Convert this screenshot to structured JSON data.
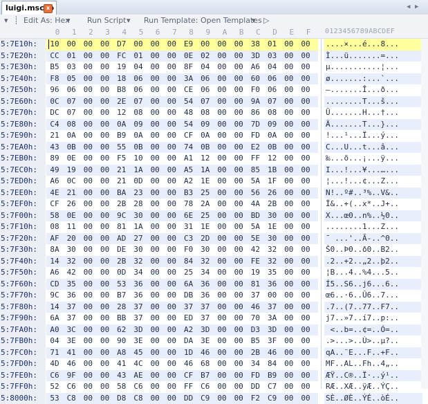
{
  "tab": {
    "title": "luigi.mscsb",
    "close_glyph": "x"
  },
  "toolbar": {
    "edit_as": "Edit As: Hex",
    "run_script": "Run Script",
    "run_template": "Run Template: Open Templates",
    "play_glyph": "▷"
  },
  "header": {
    "columns": [
      "0",
      "1",
      "2",
      "3",
      "4",
      "5",
      "6",
      "7",
      "8",
      "9",
      "A",
      "B",
      "C",
      "D",
      "E",
      "F"
    ],
    "ascii_header": "0123456789ABCDEF"
  },
  "rows": [
    {
      "addr": "5:7E10h:",
      "hex": [
        "10",
        "00",
        "00",
        "00",
        "D7",
        "00",
        "00",
        "00",
        "E9",
        "00",
        "00",
        "00",
        "38",
        "01",
        "00",
        "00"
      ],
      "ascii": "....×...é...8..."
    },
    {
      "addr": "5:7E20h:",
      "hex": [
        "CC",
        "01",
        "00",
        "00",
        "FC",
        "01",
        "00",
        "00",
        "0E",
        "02",
        "00",
        "00",
        "3D",
        "03",
        "00",
        "00"
      ],
      "ascii": "Ì...ü.......=..."
    },
    {
      "addr": "5:7E30h:",
      "hex": [
        "B5",
        "03",
        "00",
        "00",
        "19",
        "04",
        "00",
        "00",
        "8F",
        "04",
        "00",
        "00",
        "A6",
        "04",
        "00",
        "00"
      ],
      "ascii": "µ...........¦..."
    },
    {
      "addr": "5:7E40h:",
      "hex": [
        "F8",
        "05",
        "00",
        "00",
        "18",
        "06",
        "00",
        "00",
        "3A",
        "06",
        "00",
        "00",
        "60",
        "06",
        "00",
        "00"
      ],
      "ascii": "ø.......:...`..."
    },
    {
      "addr": "5:7E50h:",
      "hex": [
        "96",
        "06",
        "00",
        "00",
        "B8",
        "06",
        "00",
        "00",
        "CE",
        "06",
        "00",
        "00",
        "F0",
        "06",
        "00",
        "00"
      ],
      "ascii": "–.......Î...ð..."
    },
    {
      "addr": "5:7E60h:",
      "hex": [
        "0C",
        "07",
        "00",
        "00",
        "2E",
        "07",
        "00",
        "00",
        "54",
        "07",
        "00",
        "00",
        "9A",
        "07",
        "00",
        "00"
      ],
      "ascii": "........T...š..."
    },
    {
      "addr": "5:7E70h:",
      "hex": [
        "DC",
        "07",
        "00",
        "00",
        "12",
        "08",
        "00",
        "00",
        "48",
        "08",
        "00",
        "00",
        "86",
        "08",
        "00",
        "00"
      ],
      "ascii": "Ü.......H...†..."
    },
    {
      "addr": "5:7E80h:",
      "hex": [
        "C4",
        "08",
        "00",
        "00",
        "0A",
        "09",
        "00",
        "00",
        "54",
        "09",
        "00",
        "00",
        "7D",
        "09",
        "00",
        "00"
      ],
      "ascii": "Ä.......T...}..."
    },
    {
      "addr": "5:7E90h:",
      "hex": [
        "21",
        "0A",
        "00",
        "00",
        "B9",
        "0A",
        "00",
        "00",
        "CF",
        "0A",
        "00",
        "00",
        "FD",
        "0A",
        "00",
        "00"
      ],
      "ascii": "!...¹...Ï...ý..."
    },
    {
      "addr": "5:7EA0h:",
      "hex": [
        "43",
        "0B",
        "00",
        "00",
        "55",
        "0B",
        "00",
        "00",
        "74",
        "0B",
        "00",
        "00",
        "E2",
        "0B",
        "00",
        "00"
      ],
      "ascii": "C...U...t...â..."
    },
    {
      "addr": "5:7EB0h:",
      "hex": [
        "89",
        "0E",
        "00",
        "00",
        "F5",
        "10",
        "00",
        "00",
        "A1",
        "12",
        "00",
        "00",
        "FF",
        "12",
        "00",
        "00"
      ],
      "ascii": "‰...õ...¡...ÿ..."
    },
    {
      "addr": "5:7EC0h:",
      "hex": [
        "49",
        "19",
        "00",
        "00",
        "21",
        "1A",
        "00",
        "00",
        "A5",
        "1A",
        "00",
        "00",
        "85",
        "1B",
        "00",
        "00"
      ],
      "ascii": "I...!...¥...…..."
    },
    {
      "addr": "5:7ED0h:",
      "hex": [
        "A6",
        "0C",
        "00",
        "00",
        "21",
        "0D",
        "00",
        "00",
        "A2",
        "1E",
        "00",
        "00",
        "5A",
        "1F",
        "00",
        "00"
      ],
      "ascii": "¦...!...¢...Z..."
    },
    {
      "addr": "5:7EE0h:",
      "hex": [
        "4E",
        "21",
        "00",
        "00",
        "BA",
        "23",
        "00",
        "00",
        "B3",
        "25",
        "00",
        "00",
        "56",
        "26",
        "00",
        "00"
      ],
      "ascii": "N!..º#..³%..V&.."
    },
    {
      "addr": "5:7EF0h:",
      "hex": [
        "CF",
        "26",
        "00",
        "00",
        "2B",
        "28",
        "00",
        "00",
        "78",
        "2A",
        "00",
        "00",
        "4A",
        "2B",
        "00",
        "00"
      ],
      "ascii": "Ï&..+(..x*..J+.."
    },
    {
      "addr": "5:7F00h:",
      "hex": [
        "58",
        "0E",
        "00",
        "00",
        "9C",
        "30",
        "00",
        "00",
        "6E",
        "25",
        "00",
        "00",
        "BD",
        "30",
        "00",
        "00"
      ],
      "ascii": "X...œ0..n%..½0.."
    },
    {
      "addr": "5:7F10h:",
      "hex": [
        "08",
        "11",
        "00",
        "00",
        "81",
        "1A",
        "00",
        "00",
        "31",
        "1E",
        "00",
        "00",
        "5A",
        "1E",
        "00",
        "00"
      ],
      "ascii": "........1...Z..."
    },
    {
      "addr": "5:7F20h:",
      "hex": [
        "AF",
        "20",
        "00",
        "00",
        "AD",
        "27",
        "00",
        "00",
        "C3",
        "2D",
        "00",
        "00",
        "5E",
        "30",
        "00",
        "00"
      ],
      "ascii": "¯ ...'..Ã-..^0.."
    },
    {
      "addr": "5:7F30h:",
      "hex": [
        "8A",
        "30",
        "00",
        "00",
        "DE",
        "30",
        "00",
        "00",
        "F0",
        "30",
        "00",
        "00",
        "42",
        "32",
        "00",
        "00"
      ],
      "ascii": "Š0..Þ0..ð0..B2.."
    },
    {
      "addr": "5:7F40h:",
      "hex": [
        "14",
        "32",
        "00",
        "00",
        "2B",
        "32",
        "00",
        "00",
        "84",
        "32",
        "00",
        "00",
        "FE",
        "32",
        "00",
        "00"
      ],
      "ascii": ".2..+2..„2..þ2.."
    },
    {
      "addr": "5:7F50h:",
      "hex": [
        "A6",
        "42",
        "00",
        "00",
        "0D",
        "34",
        "00",
        "00",
        "25",
        "34",
        "00",
        "00",
        "19",
        "35",
        "00",
        "00"
      ],
      "ascii": "¦B...4..%4...5.."
    },
    {
      "addr": "5:7F60h:",
      "hex": [
        "CD",
        "35",
        "00",
        "00",
        "53",
        "36",
        "00",
        "00",
        "6A",
        "36",
        "00",
        "00",
        "81",
        "36",
        "00",
        "00"
      ],
      "ascii": "Í5..S6..j6...6.."
    },
    {
      "addr": "5:7F70h:",
      "hex": [
        "9C",
        "36",
        "00",
        "00",
        "B7",
        "36",
        "00",
        "00",
        "DB",
        "36",
        "00",
        "00",
        "37",
        "00",
        "00",
        "00"
      ],
      "ascii": "œ6..·6..Û6..7..."
    },
    {
      "addr": "5:7F80h:",
      "hex": [
        "14",
        "37",
        "00",
        "00",
        "28",
        "37",
        "00",
        "00",
        "37",
        "37",
        "00",
        "00",
        "46",
        "37",
        "00",
        "00"
      ],
      "ascii": ".7..(7..77..F7.."
    },
    {
      "addr": "5:7F90h:",
      "hex": [
        "6A",
        "37",
        "00",
        "00",
        "BB",
        "37",
        "00",
        "00",
        "ED",
        "37",
        "00",
        "00",
        "70",
        "3A",
        "00",
        "00"
      ],
      "ascii": "j7..»7..í7..p:.."
    },
    {
      "addr": "5:7FA0h:",
      "hex": [
        "A0",
        "3C",
        "00",
        "00",
        "62",
        "3D",
        "00",
        "00",
        "A2",
        "3D",
        "00",
        "00",
        "D3",
        "3D",
        "00",
        "00"
      ],
      "ascii": " <..b=..¢=..Ó=.."
    },
    {
      "addr": "5:7FB0h:",
      "hex": [
        "04",
        "3E",
        "00",
        "00",
        "90",
        "3E",
        "00",
        "00",
        "DA",
        "3E",
        "00",
        "00",
        "B5",
        "3F",
        "00",
        "00"
      ],
      "ascii": ".>...>..Ú>..µ?.."
    },
    {
      "addr": "5:7FC0h:",
      "hex": [
        "71",
        "41",
        "00",
        "00",
        "A8",
        "45",
        "00",
        "00",
        "1D",
        "46",
        "00",
        "00",
        "2B",
        "46",
        "00",
        "00"
      ],
      "ascii": "qA..¨E...F..+F.."
    },
    {
      "addr": "5:7FD0h:",
      "hex": [
        "4D",
        "46",
        "00",
        "00",
        "41",
        "4C",
        "00",
        "00",
        "46",
        "68",
        "00",
        "00",
        "34",
        "84",
        "00",
        "00"
      ],
      "ascii": "MF..AL..Fh..4„.."
    },
    {
      "addr": "5:7FE0h:",
      "hex": [
        "C6",
        "9F",
        "00",
        "00",
        "43",
        "AE",
        "00",
        "00",
        "CF",
        "B7",
        "00",
        "00",
        "FD",
        "B9",
        "00",
        "00"
      ],
      "ascii": "ÆŸ..C®..Ï·..ý¹.."
    },
    {
      "addr": "5:7FF0h:",
      "hex": [
        "52",
        "C6",
        "00",
        "00",
        "58",
        "C6",
        "00",
        "00",
        "FF",
        "C6",
        "00",
        "00",
        "DD",
        "C7",
        "00",
        "00"
      ],
      "ascii": "RÆ..XÆ..ÿÆ..ÝÇ.."
    },
    {
      "addr": "5:8000h:",
      "hex": [
        "53",
        "C8",
        "00",
        "00",
        "D8",
        "C8",
        "00",
        "00",
        "DD",
        "C9",
        "00",
        "00",
        "F2",
        "C9",
        "00",
        "00"
      ],
      "ascii": "SÈ..ØÈ..ÝÉ..òÉ.."
    }
  ]
}
